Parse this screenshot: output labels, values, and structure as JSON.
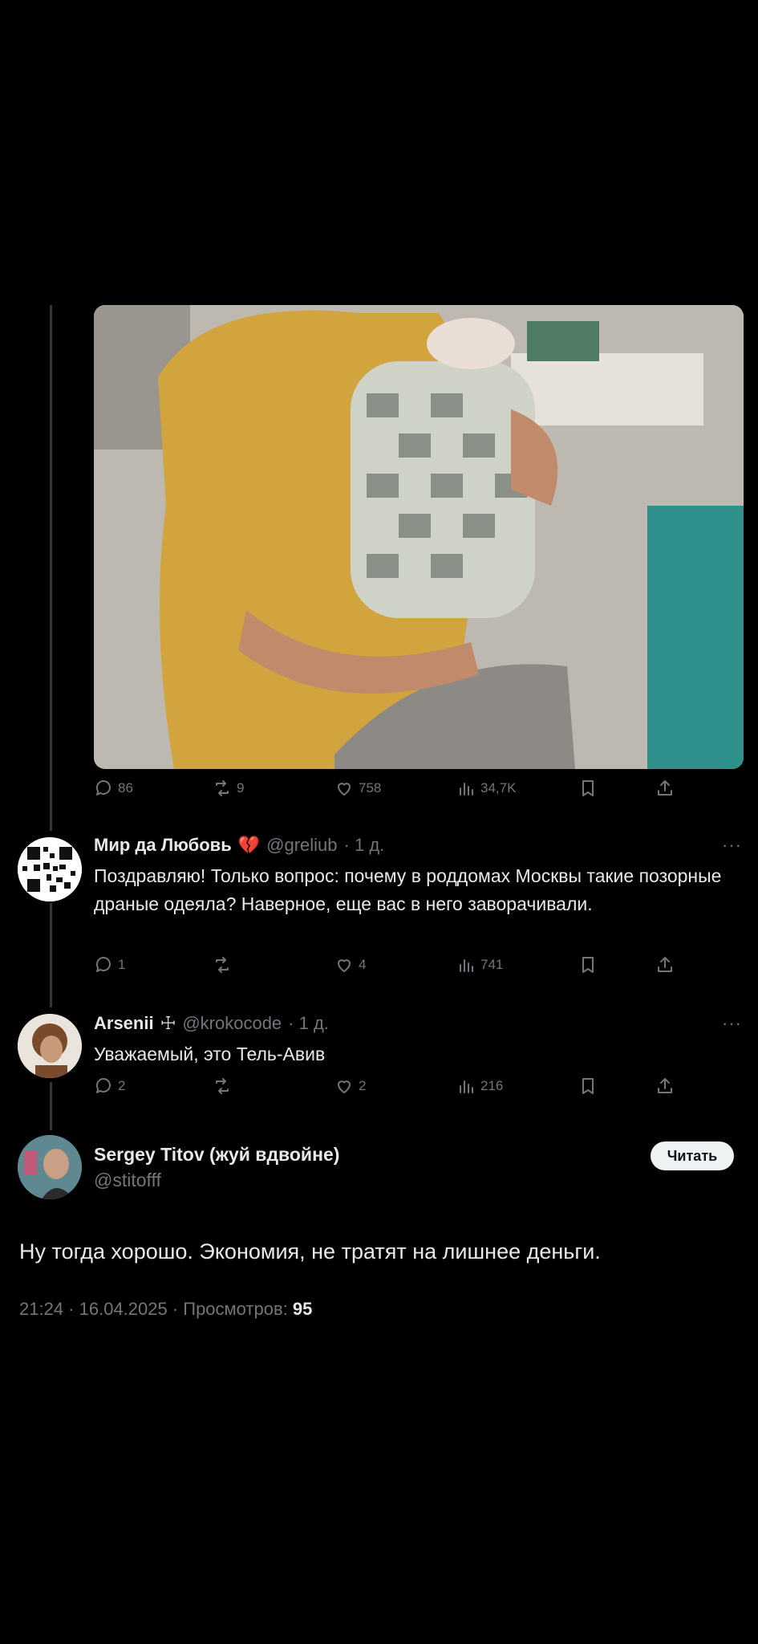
{
  "media": {
    "alt_icon": "photo-of-man-holding-newborn"
  },
  "top_tweet_actions": {
    "replies": "86",
    "reposts": "9",
    "likes": "758",
    "views": "34,7K"
  },
  "reply1": {
    "name": "Мир да Любовь",
    "emoji": "💔",
    "handle": "@greliub",
    "time": "· 1 д.",
    "more": "···",
    "text": "Поздравляю! Только вопрос: почему в роддомах Москвы такие позорные драные одеяла? Наверное, еще вас в него заворачивали.",
    "replies": "1",
    "reposts": "",
    "likes": "4",
    "views": "741"
  },
  "reply2": {
    "name": "Arsenii",
    "badge": "☩",
    "handle": "@krokocode",
    "time": "· 1 д.",
    "more": "···",
    "text": "Уважаемый, это Тель-Авив",
    "replies": "2",
    "reposts": "",
    "likes": "2",
    "views": "216"
  },
  "main_tweet": {
    "name": "Sergey Titov (жуй вдвойне)",
    "handle": "@stitofff",
    "follow_label": "Читать",
    "text": "Ну тогда хорошо. Экономия, не тратят на лишнее деньги.",
    "meta": "21:24 · 16.04.2025 · Просмотров: ",
    "views": "95"
  },
  "colors": {
    "background": "#000000",
    "text": "#e7e9ea",
    "muted": "#71767b",
    "thread_line": "#333639"
  }
}
